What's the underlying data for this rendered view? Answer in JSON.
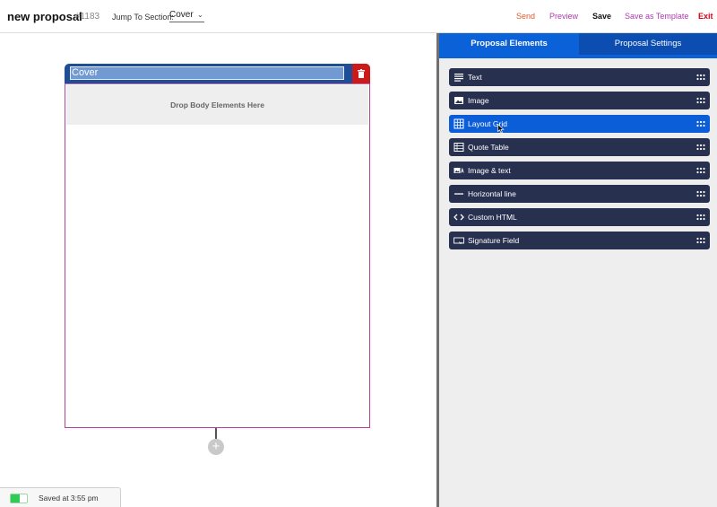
{
  "header": {
    "title": "new proposal",
    "number": "#1183",
    "jump_label": "Jump To Section:",
    "jump_value": "Cover",
    "actions": {
      "send": "Send",
      "preview": "Preview",
      "save": "Save",
      "save_template": "Save as Template",
      "exit": "Exit"
    }
  },
  "canvas": {
    "section_name": "Cover",
    "drop_text": "Drop Body Elements Here",
    "add_symbol": "+"
  },
  "status": {
    "saved_text": "Saved at 3:55 pm"
  },
  "panel": {
    "tabs": [
      "Proposal Elements",
      "Proposal Settings"
    ],
    "active_tab": "Proposal Elements",
    "elements": [
      {
        "label": "Text",
        "icon": "text-icon"
      },
      {
        "label": "Image",
        "icon": "image-icon"
      },
      {
        "label": "Layout Grid",
        "icon": "grid-icon"
      },
      {
        "label": "Quote Table",
        "icon": "table-icon"
      },
      {
        "label": "Image & text",
        "icon": "image-text-icon"
      },
      {
        "label": "Horizontal line",
        "icon": "line-icon"
      },
      {
        "label": "Custom HTML",
        "icon": "code-icon"
      },
      {
        "label": "Signature Field",
        "icon": "signature-icon"
      }
    ],
    "hovered_element": "Layout Grid"
  },
  "colors": {
    "element_bg": "#283050",
    "element_active": "#0b5ed7",
    "tab_active": "#0b61d8",
    "section_header": "#1f4e96",
    "delete": "#cc1a1a",
    "send": "#e05a2b",
    "preview": "#b03ab0",
    "exit": "#d4001a"
  }
}
